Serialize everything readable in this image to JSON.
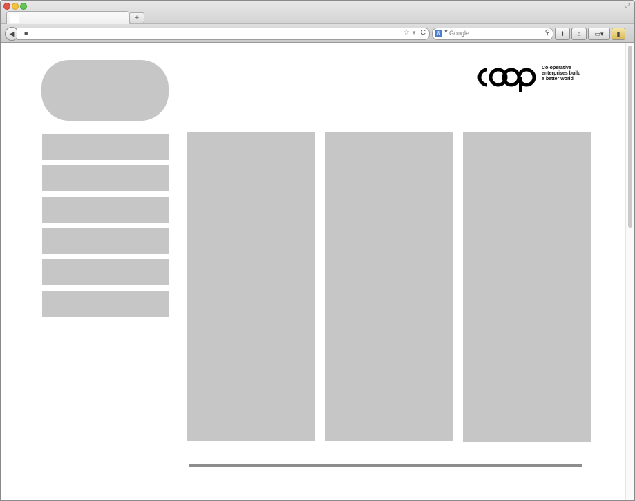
{
  "browser": {
    "new_tab_label": "+",
    "search_placeholder": "Google",
    "search_engine_letter": "8"
  },
  "page": {
    "brand_logo_text": "coop",
    "tagline": [
      "Co-operative",
      "enterprises build",
      "a better world"
    ],
    "nav_items": [
      "",
      "",
      "",
      "",
      "",
      ""
    ],
    "placeholder_color": "#c6c6c6"
  }
}
